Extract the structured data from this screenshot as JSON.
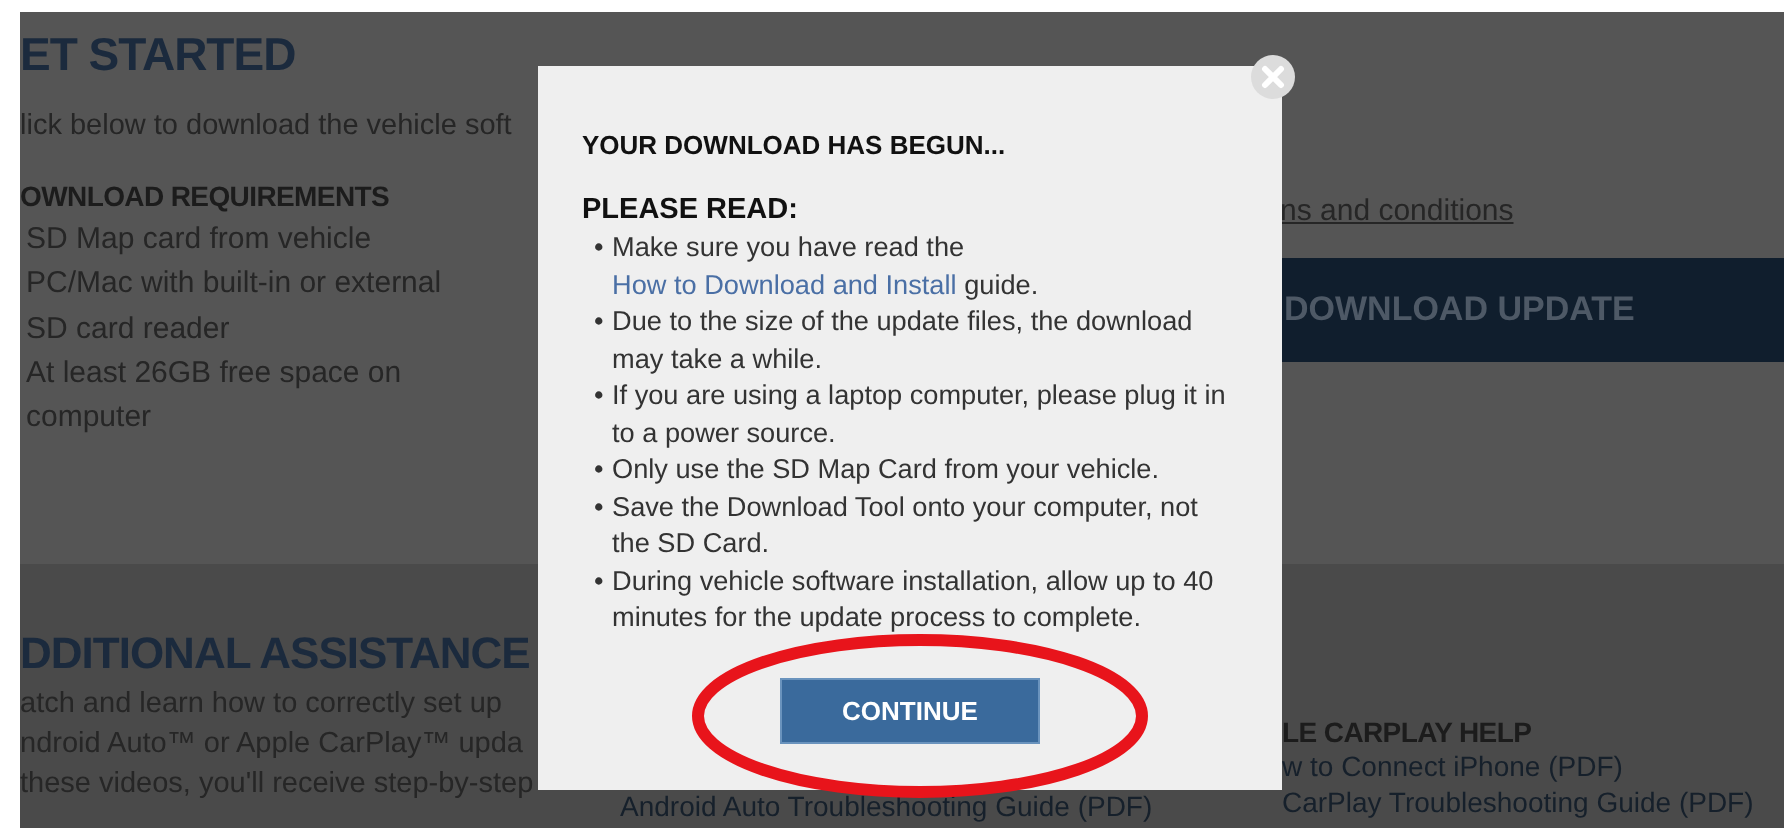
{
  "page": {
    "heading": "ET STARTED",
    "intro": "lick below to download the vehicle soft",
    "requirements_heading": "OWNLOAD REQUIREMENTS",
    "requirements": [
      "SD Map card from vehicle",
      "PC/Mac with built-in or external SD card reader",
      "At least 26GB free space on computer"
    ],
    "terms_link": "ns and conditions",
    "download_button": "DOWNLOAD UPDATE"
  },
  "assistance": {
    "heading": "DDITIONAL ASSISTANCE",
    "body_lines": [
      "atch and learn how to correctly set up",
      "ndroid Auto™ or Apple CarPlay™ upda",
      "these videos, you'll receive step-by-step"
    ],
    "column_2_links": [
      "Android Auto Troubleshooting Guide (PDF)"
    ],
    "carplay_heading": "LE CARPLAY HELP",
    "carplay_links": [
      "w to Connect iPhone (PDF)",
      "CarPlay Troubleshooting Guide (PDF)"
    ]
  },
  "modal": {
    "title": "YOUR DOWNLOAD HAS BEGUN...",
    "subtitle": "PLEASE READ:",
    "items": [
      {
        "marker": "•",
        "text": "Make sure you have read the ",
        "link": "How to Download and Install",
        "after": " guide."
      },
      {
        "marker": "•",
        "text": "Due to the size of the update files, the download may take a while."
      },
      {
        "marker": "•",
        "text": "If you are using a laptop computer, please plug it in to a power source."
      },
      {
        "marker": "•",
        "text": "Only use the SD Map Card from your vehicle."
      },
      {
        "marker": "•",
        "text": "Save the Download Tool onto your computer, not the SD Card."
      },
      {
        "marker": "•",
        "text": "During vehicle software installation, allow up to 40 minutes for the update process to complete."
      }
    ],
    "button": "CONTINUE"
  }
}
